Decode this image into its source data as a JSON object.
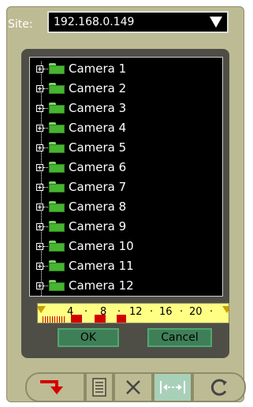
{
  "site": {
    "label": "Site:",
    "value": "192.168.0.149"
  },
  "cameras": [
    "Camera 1",
    "Camera 2",
    "Camera 3",
    "Camera 4",
    "Camera 5",
    "Camera 6",
    "Camera 7",
    "Camera 8",
    "Camera 9",
    "Camera 10",
    "Camera 11",
    "Camera 12"
  ],
  "timebar": {
    "hour_labels": [
      "4",
      "8",
      "12",
      "16",
      "20"
    ]
  },
  "buttons": {
    "ok": "OK",
    "cancel": "Cancel"
  },
  "toolbar": {
    "items": [
      {
        "name": "export-icon"
      },
      {
        "name": "list-icon"
      },
      {
        "name": "close-icon"
      },
      {
        "name": "fit-width-icon",
        "active": true
      },
      {
        "name": "refresh-icon"
      }
    ]
  },
  "colors": {
    "background": "#bdbb93",
    "timebar": "#ffff84",
    "recording": "#d30000",
    "button": "#3f7f58"
  }
}
